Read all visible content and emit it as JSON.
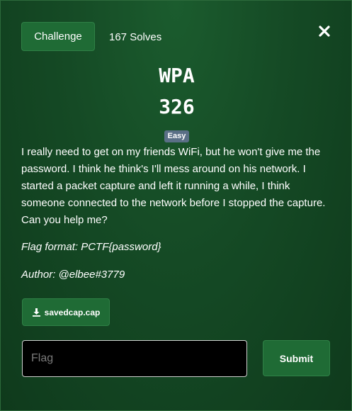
{
  "header": {
    "tab_label": "Challenge",
    "solves": "167 Solves"
  },
  "close_icon": "close-icon",
  "challenge": {
    "name": "WPA",
    "points": "326",
    "difficulty": "Easy",
    "description": "I really need to get on my friends WiFi, but he won't give me the password. I think he think's I'll mess around on his network. I started a packet capture and left it running a while, I think someone connected to the network before I stopped the capture. Can you help me?",
    "flag_format": "Flag format: PCTF{password}",
    "author": "Author: @elbee#3779"
  },
  "file": {
    "icon": "download-icon",
    "name": "savedcap.cap"
  },
  "form": {
    "placeholder": "Flag",
    "value": "",
    "submit_label": "Submit"
  },
  "colors": {
    "accent": "#1f6b35",
    "background": "#154a25",
    "badge": "#5a6f86"
  }
}
